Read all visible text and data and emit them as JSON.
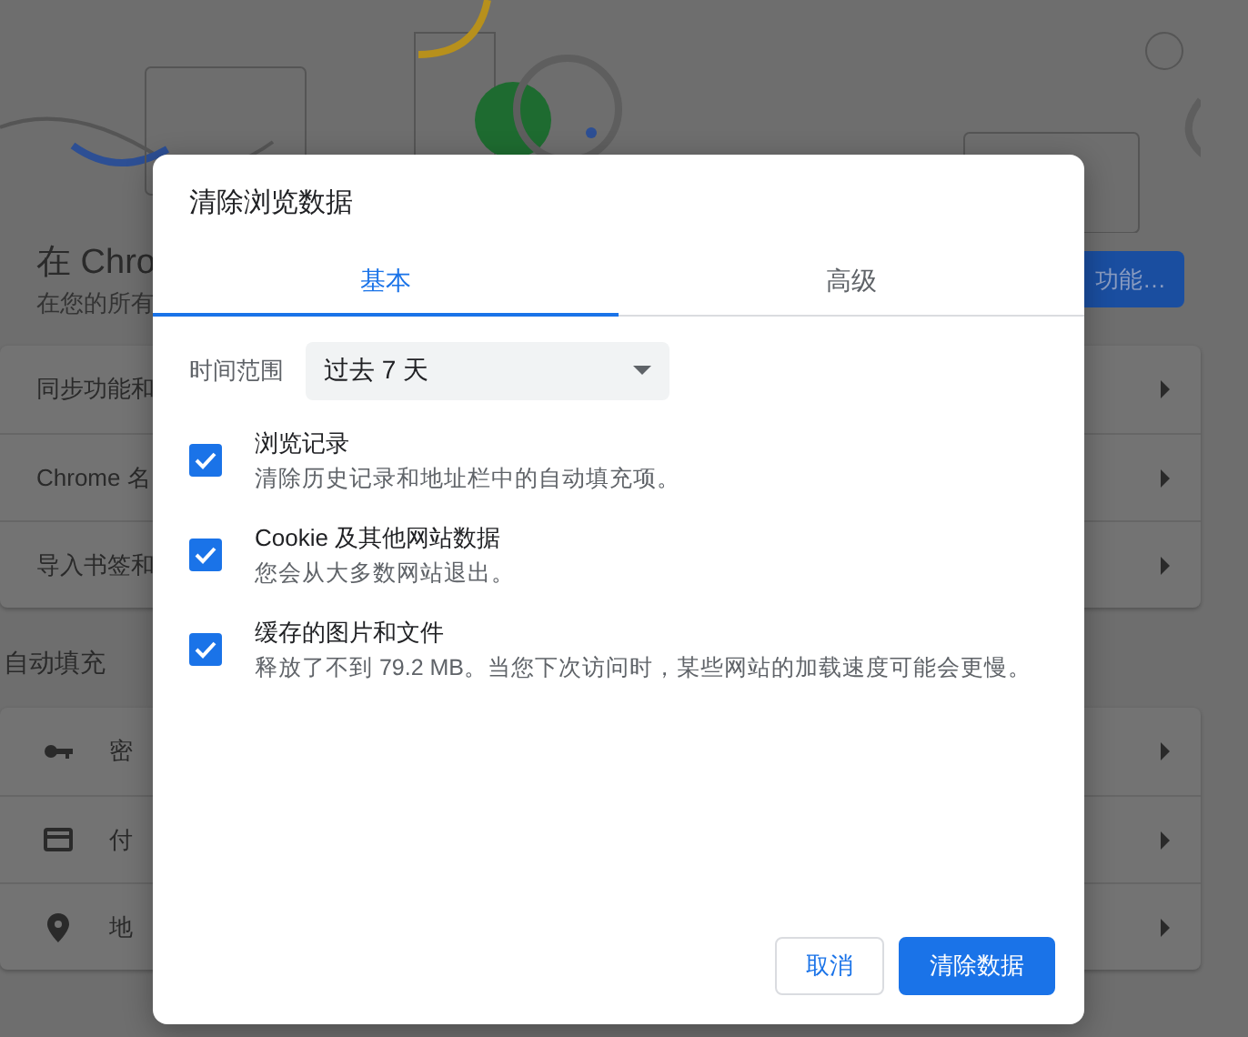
{
  "background": {
    "banner_title": "在 Chro",
    "banner_subtitle": "在您的所有",
    "banner_button": "功能…",
    "rows": [
      {
        "label": "同步功能和"
      },
      {
        "label": "Chrome 名"
      },
      {
        "label": "导入书签和"
      }
    ],
    "autofill_heading": "自动填充",
    "autofill_rows": [
      {
        "label": "密"
      },
      {
        "label": "付"
      },
      {
        "label": "地"
      }
    ]
  },
  "dialog": {
    "title": "清除浏览数据",
    "tabs": [
      {
        "label": "基本",
        "selected": true
      },
      {
        "label": "高级",
        "selected": false
      }
    ],
    "time_range": {
      "label": "时间范围",
      "value": "过去 7 天"
    },
    "options": [
      {
        "title": "浏览记录",
        "description": "清除历史记录和地址栏中的自动填充项。",
        "checked": true
      },
      {
        "title": "Cookie 及其他网站数据",
        "description": "您会从大多数网站退出。",
        "checked": true
      },
      {
        "title": "缓存的图片和文件",
        "description": "释放了不到 79.2 MB。当您下次访问时，某些网站的加载速度可能会更慢。",
        "checked": true
      }
    ],
    "buttons": [
      {
        "label": "取消",
        "kind": "secondary"
      },
      {
        "label": "清除数据",
        "kind": "primary"
      }
    ]
  }
}
